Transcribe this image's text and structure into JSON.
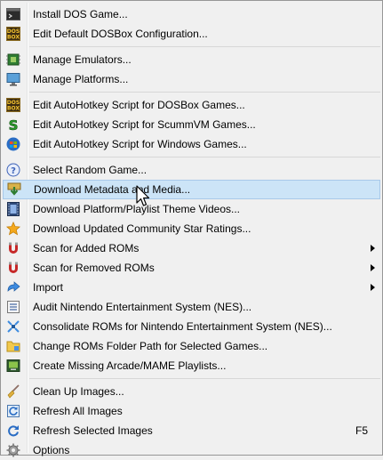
{
  "menu": {
    "groups": [
      [
        {
          "label": "Install DOS Game...",
          "icon": "console-icon"
        },
        {
          "label": "Edit Default DOSBox Configuration...",
          "icon": "dosbox-icon"
        }
      ],
      [
        {
          "label": "Manage Emulators...",
          "icon": "chip-icon"
        },
        {
          "label": "Manage Platforms...",
          "icon": "monitor-icon"
        }
      ],
      [
        {
          "label": "Edit AutoHotkey Script for DOSBox Games...",
          "icon": "dosbox-icon"
        },
        {
          "label": "Edit AutoHotkey Script for ScummVM Games...",
          "icon": "scummvm-icon"
        },
        {
          "label": "Edit AutoHotkey Script for Windows Games...",
          "icon": "windows-icon"
        }
      ],
      [
        {
          "label": "Select Random Game...",
          "icon": "question-icon"
        },
        {
          "label": "Download Metadata and Media...",
          "icon": "download-icon",
          "highlighted": true
        },
        {
          "label": "Download Platform/Playlist Theme Videos...",
          "icon": "film-icon"
        },
        {
          "label": "Download Updated Community Star Ratings...",
          "icon": "star-icon"
        },
        {
          "label": "Scan for Added ROMs",
          "icon": "magnet-icon",
          "submenu": true
        },
        {
          "label": "Scan for Removed ROMs",
          "icon": "magnet-icon",
          "submenu": true
        },
        {
          "label": "Import",
          "icon": "import-arrow-icon",
          "submenu": true
        },
        {
          "label": "Audit Nintendo Entertainment System (NES)...",
          "icon": "list-icon"
        },
        {
          "label": "Consolidate ROMs for Nintendo Entertainment System (NES)...",
          "icon": "consolidate-icon"
        },
        {
          "label": "Change ROMs Folder Path for Selected Games...",
          "icon": "folder-icon"
        },
        {
          "label": "Create Missing Arcade/MAME Playlists...",
          "icon": "arcade-icon"
        }
      ],
      [
        {
          "label": "Clean Up Images...",
          "icon": "broom-icon"
        },
        {
          "label": "Refresh All Images",
          "icon": "refresh-all-icon"
        },
        {
          "label": "Refresh Selected Images",
          "icon": "refresh-icon",
          "shortcut": "F5"
        },
        {
          "label": "Options",
          "icon": "gear-icon"
        }
      ]
    ]
  },
  "colors": {
    "menu_bg": "#f0f0f0",
    "highlight_bg": "#cce4f7",
    "highlight_border": "#a8c9e9",
    "separator": "#d7d7d7"
  }
}
